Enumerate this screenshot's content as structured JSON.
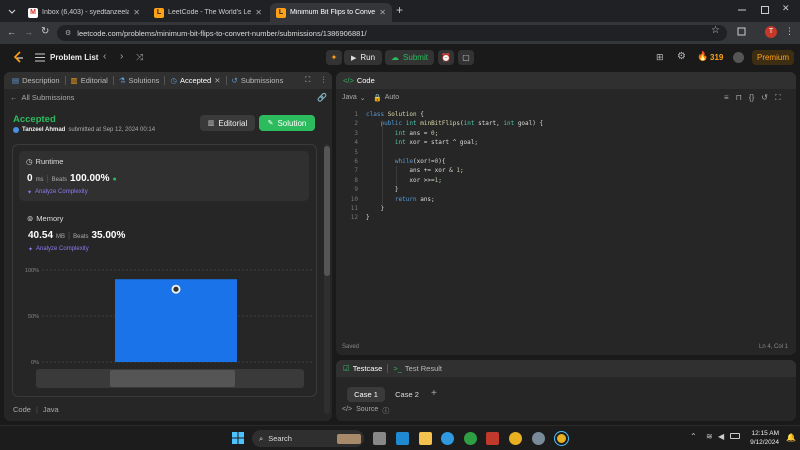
{
  "browser": {
    "tabs": [
      {
        "title": "Inbox (6,403) - syedtanzeelay@",
        "icon": "gmail-icon"
      },
      {
        "title": "LeetCode - The World's Leadin",
        "icon": "leetcode-icon"
      },
      {
        "title": "Minimum Bit Flips to Convert N",
        "icon": "leetcode-icon",
        "active": true
      }
    ],
    "new_tab": "+",
    "url": "leetcode.com/problems/minimum-bit-flips-to-convert-number/submissions/1386906881/",
    "profile_initial": "T"
  },
  "header": {
    "problem_list": "Problem List",
    "run": "Run",
    "submit": "Submit",
    "streak": "319",
    "premium": "Premium"
  },
  "left": {
    "tabs": [
      {
        "label": "Description",
        "icon": "description-icon"
      },
      {
        "label": "Editorial",
        "icon": "editorial-icon"
      },
      {
        "label": "Solutions",
        "icon": "flask-icon"
      },
      {
        "label": "Accepted",
        "icon": "clock-icon",
        "active": true
      },
      {
        "label": "Submissions",
        "icon": "history-icon"
      }
    ],
    "all_submissions": "All Submissions",
    "status": "Accepted",
    "author": "Tanzeel Ahmad",
    "submitted_text": "submitted at Sep 12, 2024 00:14",
    "editorial_btn": "Editorial",
    "solution_btn": "Solution",
    "runtime": {
      "title": "Runtime",
      "value": "0",
      "unit": "ms",
      "beats_label": "Beats",
      "beats": "100.00%",
      "analyze": "Analyze Complexity"
    },
    "memory": {
      "title": "Memory",
      "value": "40.54",
      "unit": "MB",
      "beats_label": "Beats",
      "beats": "35.00%",
      "analyze": "Analyze Complexity"
    },
    "chart_ticks": [
      "100%",
      "50%",
      "0%"
    ],
    "footer_code": "Code",
    "footer_lang": "Java"
  },
  "chart_data": {
    "type": "bar",
    "categories": [
      ""
    ],
    "values": [
      90
    ],
    "ylim": [
      0,
      100
    ],
    "ytick_labels": [
      "100%",
      "50%",
      "0%"
    ],
    "color": "#1a73e8"
  },
  "code_panel": {
    "title": "Code",
    "language": "Java",
    "auto": "Auto",
    "status": "Saved",
    "cursor": "Ln 4, Col 1",
    "lines": [
      "class Solution {",
      "    public int minBitFlips(int start, int goal) {",
      "        int ans = 0;",
      "        int xor = start ^ goal;",
      "",
      "        while(xor!=0){",
      "            ans += xor & 1;",
      "            xor >>=1;",
      "        }",
      "        return ans;",
      "    }",
      "}"
    ]
  },
  "testcase": {
    "tab1": "Testcase",
    "tab2": "Test Result",
    "cases": [
      "Case 1",
      "Case 2"
    ],
    "add": "+",
    "source": "Source"
  },
  "taskbar": {
    "search": "Search",
    "time": "12:15 AM",
    "date": "9/12/2024"
  },
  "colors": {
    "accent_green": "#2cbb5d",
    "accepted": "#2cbb5d",
    "analyze_purple": "#8a7cf0",
    "bar_blue": "#1a73e8",
    "streak_orange": "#ffa116",
    "premium_bg": "#3d2e13"
  }
}
